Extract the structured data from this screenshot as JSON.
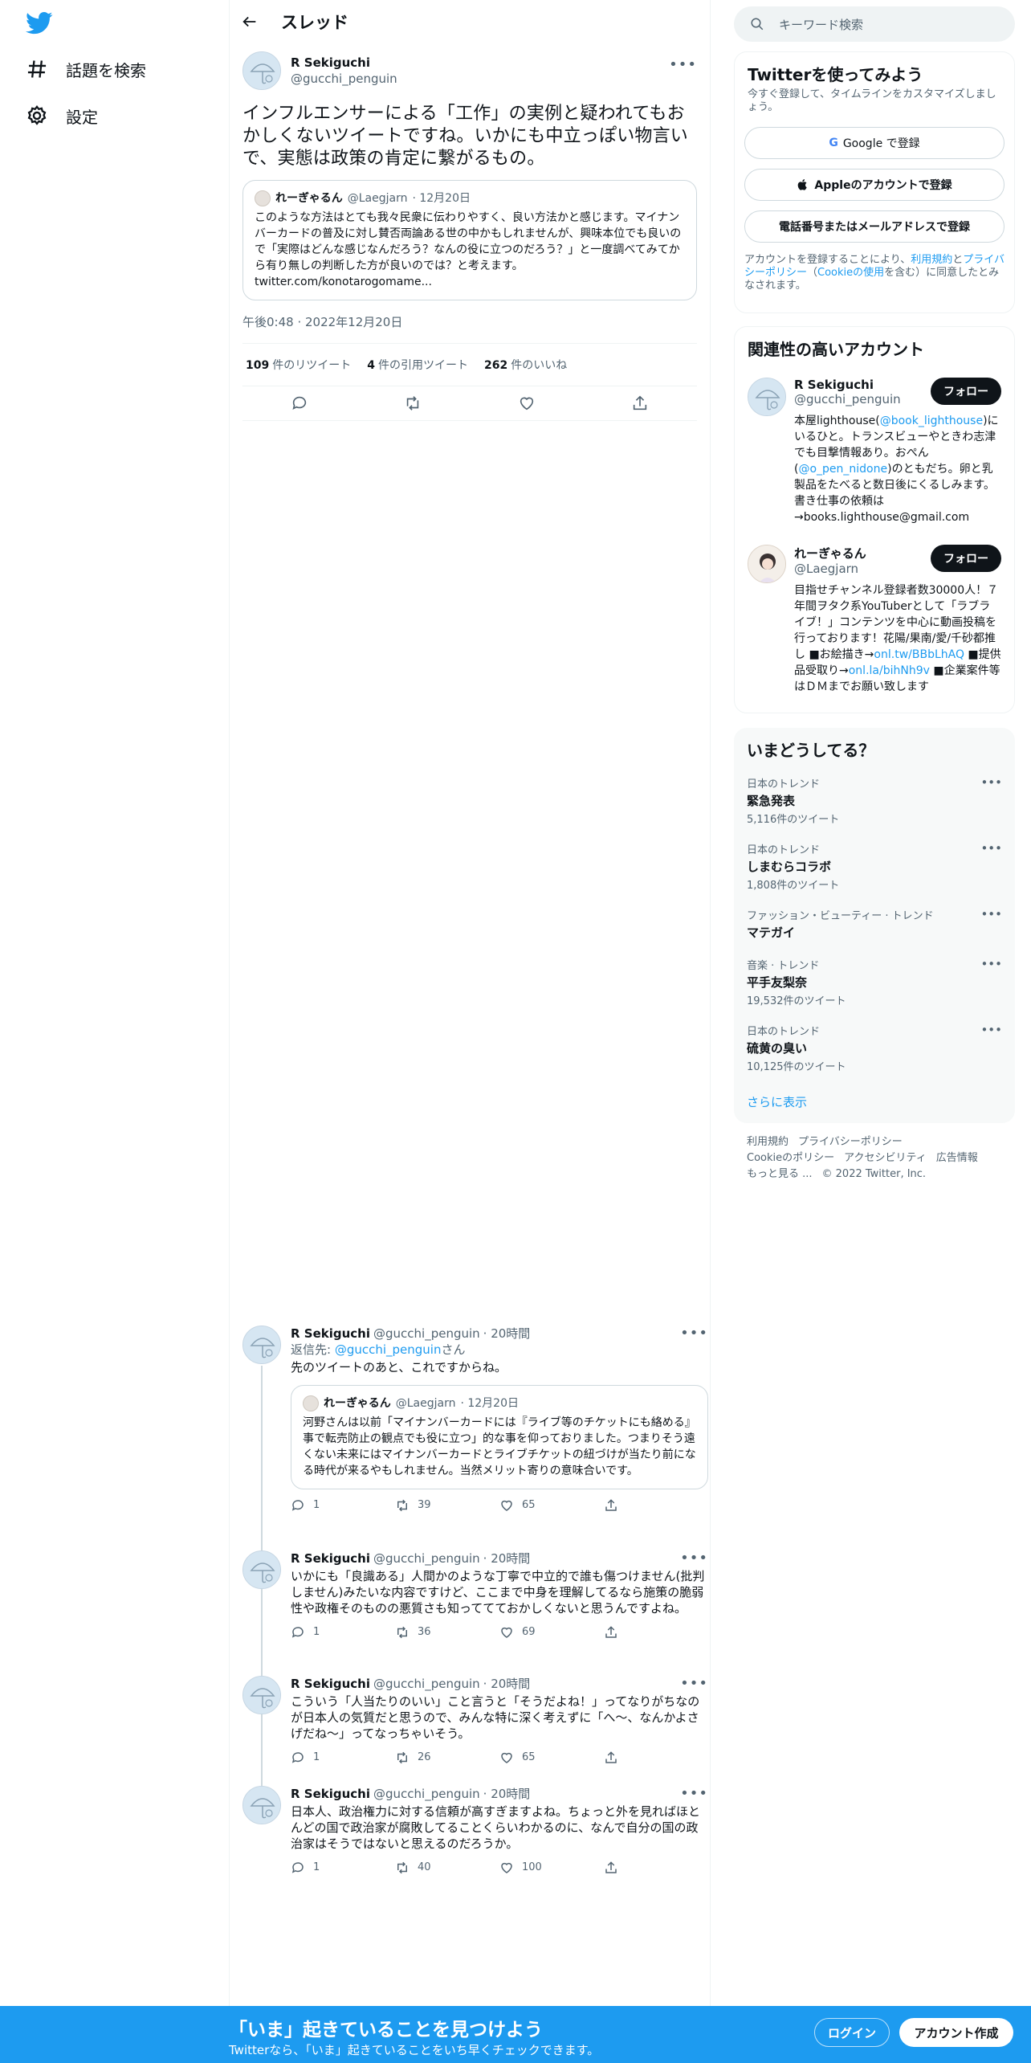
{
  "nav": {
    "explore": "話題を検索",
    "settings": "設定"
  },
  "header": {
    "title": "スレッド"
  },
  "focal": {
    "name": "R Sekiguchi",
    "handle": "@gucchi_penguin",
    "text": "インフルエンサーによる「工作」の実例と疑われてもおかしくないツイートですね。いかにも中立っぽい物言いで、実態は政策の肯定に繋がるもの。",
    "quote": {
      "name": "れーぎゃるん",
      "handle": "@Laegjarn",
      "date": "· 12月20日",
      "text": "このような方法はとても我々民衆に伝わりやすく、良い方法かと感じます。マイナンバーカードの普及に対し賛否両論ある世の中かもしれませんが、興味本位でも良いので「実際はどんな感じなんだろう？なんの役に立つのだろう？」と一度調べてみてから有り無しの判断した方が良いのでは？と考えます。",
      "link": "twitter.com/konotarogomame..."
    },
    "timestamp": "午後0:48 · 2022年12月20日",
    "retweets": "109",
    "retweets_label": "件のリツイート",
    "quotes": "4",
    "quotes_label": "件の引用ツイート",
    "likes": "262",
    "likes_label": "件のいいね"
  },
  "replies": [
    {
      "name": "R Sekiguchi",
      "handle": "@gucchi_penguin",
      "time": "· 20時間",
      "reply_to_label": "返信先: ",
      "reply_to_handle": "@gucchi_penguin",
      "reply_to_suffix": "さん",
      "text": "先のツイートのあと、これですからね。",
      "quote": {
        "name": "れーぎゃるん",
        "handle": "@Laegjarn",
        "date": "· 12月20日",
        "text": "河野さんは以前「マイナンバーカードには『ライブ等のチケットにも絡める』事で転売防止の観点でも役に立つ」的な事を仰っておりました。つまりそう遠くない未来にはマイナンバーカードとライブチケットの紐づけが当たり前になる時代が来るやもしれません。当然メリット寄りの意味合いです。"
      },
      "replies": "1",
      "retweets": "39",
      "likes": "65"
    },
    {
      "name": "R Sekiguchi",
      "handle": "@gucchi_penguin",
      "time": "· 20時間",
      "text": "いかにも「良識ある」人間かのような丁寧で中立的で誰も傷つけません(批判しません)みたいな内容ですけど、ここまで中身を理解してるなら施策の脆弱性や政権そのものの悪質さも知っててておかしくないと思うんですよね。",
      "replies": "1",
      "retweets": "36",
      "likes": "69"
    },
    {
      "name": "R Sekiguchi",
      "handle": "@gucchi_penguin",
      "time": "· 20時間",
      "text": "こういう「人当たりのいい」こと言うと「そうだよね！」ってなりがちなのが日本人の気質だと思うので、みんな特に深く考えずに「へ〜、なんかよさげだね〜」ってなっちゃいそう。",
      "replies": "1",
      "retweets": "26",
      "likes": "65"
    },
    {
      "name": "R Sekiguchi",
      "handle": "@gucchi_penguin",
      "time": "· 20時間",
      "text": "日本人、政治権力に対する信頼が高すぎますよね。ちょっと外を見ればほとんどの国で政治家が腐敗してることくらいわかるのに、なんで自分の国の政治家はそうではないと思えるのだろうか。",
      "replies": "1",
      "retweets": "40",
      "likes": "100"
    }
  ],
  "search": {
    "placeholder": "キーワード検索"
  },
  "signup": {
    "title": "Twitterを使ってみよう",
    "subtitle": "今すぐ登録して、タイムラインをカスタマイズしましょう。",
    "google": "Google で登録",
    "apple": "Appleのアカウントで登録",
    "phone": "電話番号またはメールアドレスで登録",
    "legal_prefix": "アカウントを登録することにより、",
    "legal_terms": "利用規約",
    "legal_and": "と",
    "legal_privacy": "プライバシーポリシー",
    "legal_cookie_open": "（",
    "legal_cookie": "Cookieの使用",
    "legal_suffix": "を含む）に同意したとみなされます。"
  },
  "related": {
    "title": "関連性の高いアカウント",
    "follow_label": "フォロー",
    "accounts": [
      {
        "name": "R Sekiguchi",
        "handle": "@gucchi_penguin",
        "bio_1": "本屋lighthouse(",
        "bio_link1": "@book_lighthouse",
        "bio_2": ")にいるひと。トランスビューやときわ志津でも目撃情報あり。おぺん(",
        "bio_link2": "@o_pen_nidone",
        "bio_3": ")のともだち。卵と乳製品をたべると数日後にくるしみます。書き仕事の依頼は→books.lighthouse@gmail.com"
      },
      {
        "name": "れーぎゃるん",
        "handle": "@Laegjarn",
        "bio_1": "目指せチャンネル登録者数30000人！７年間ヲタク系YouTuberとして「ラブライブ！」コンテンツを中心に動画投稿を行っております！花陽/果南/愛/千砂都推し ■お絵描き→",
        "bio_link1": "onl.tw/BBbLhAQ",
        "bio_2": " ■提供品受取り→",
        "bio_link2": "onl.la/bihNh9v",
        "bio_3": " ■企業案件等はＤＭまでお願い致します"
      }
    ]
  },
  "trends": {
    "title": "いまどうしてる？",
    "items": [
      {
        "category": "日本のトレンド",
        "name": "緊急発表",
        "count": "5,116件のツイート"
      },
      {
        "category": "日本のトレンド",
        "name": "しまむらコラボ",
        "count": "1,808件のツイート"
      },
      {
        "category": "ファッション・ビューティー · トレンド",
        "name": "マテガイ",
        "count": ""
      },
      {
        "category": "音楽 · トレンド",
        "name": "平手友梨奈",
        "count": "19,532件のツイート"
      },
      {
        "category": "日本のトレンド",
        "name": "硫黄の臭い",
        "count": "10,125件のツイート"
      }
    ],
    "show_more": "さらに表示"
  },
  "footer": {
    "terms": "利用規約",
    "privacy": "プライバシーポリシー",
    "cookie": "Cookieのポリシー",
    "accessibility": "アクセシビリティ",
    "ads": "広告情報",
    "more": "もっと見る ...",
    "copyright": "© 2022 Twitter, Inc."
  },
  "bottom_bar": {
    "title": "「いま」起きていることを見つけよう",
    "subtitle": "Twitterなら、「いま」起きていることをいち早くチェックできます。",
    "login": "ログイン",
    "signup": "アカウント作成"
  },
  "colors": {
    "brand": "#1d9bf0",
    "text": "#0f1419",
    "muted": "#536471"
  }
}
